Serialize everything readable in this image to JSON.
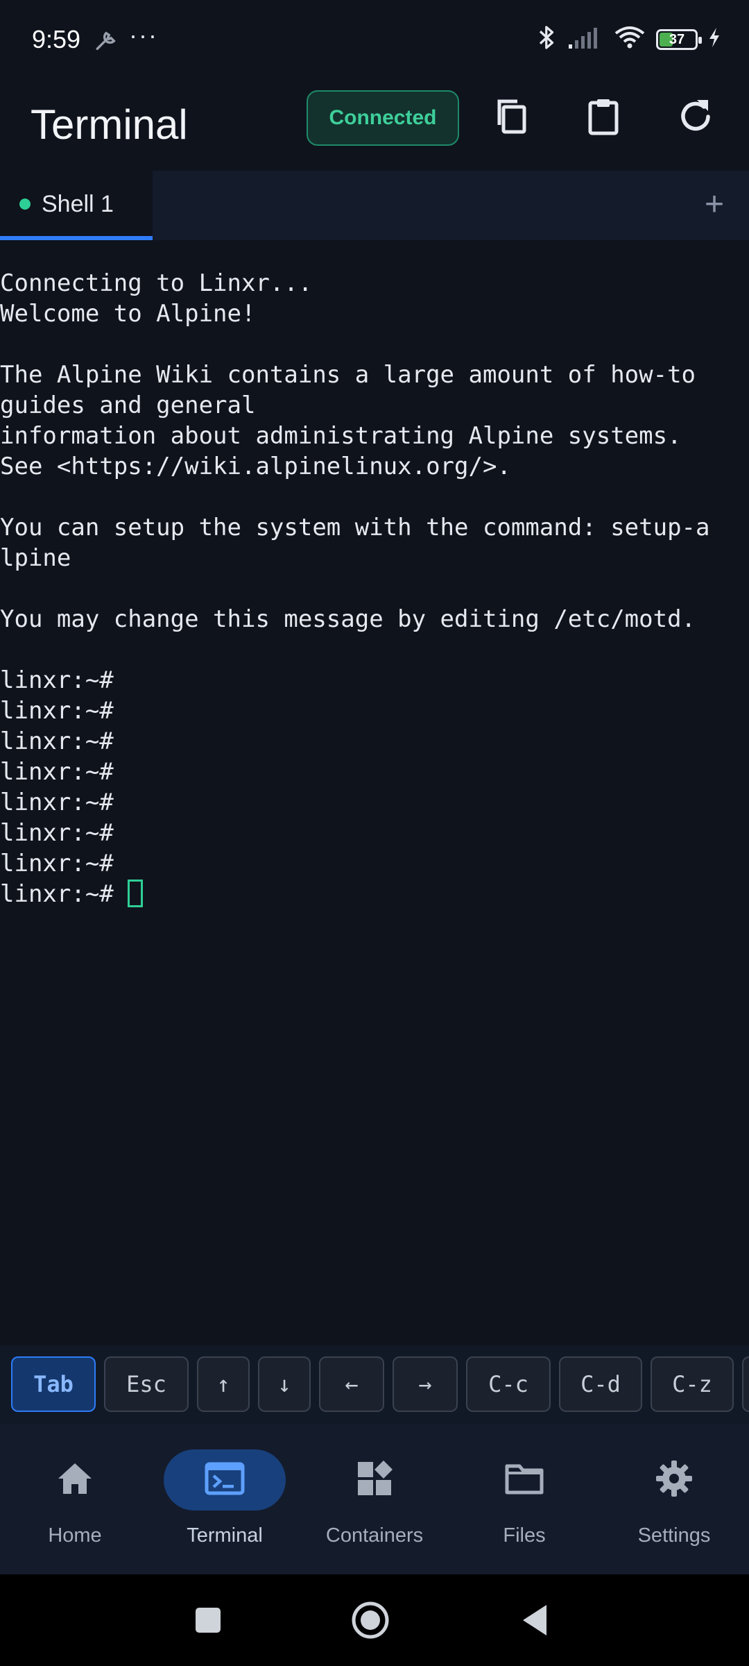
{
  "status_bar": {
    "time": "9:59",
    "dots": "···",
    "battery": "37",
    "icons": [
      "wrench-icon",
      "bluetooth-icon",
      "signal-icon",
      "wifi-icon",
      "battery-icon",
      "charging-icon"
    ]
  },
  "header": {
    "title": "Terminal",
    "connection_status": "Connected",
    "actions": [
      "copy-icon",
      "paste-icon",
      "refresh-icon"
    ]
  },
  "tabs": [
    {
      "label": "Shell 1",
      "active": true
    }
  ],
  "terminal": {
    "lines": [
      "Connecting to Linxr...",
      "Welcome to Alpine!",
      "",
      "The Alpine Wiki contains a large amount of how-to",
      "guides and general",
      "information about administrating Alpine systems.",
      "See <https://wiki.alpinelinux.org/>.",
      "",
      "You can setup the system with the command: setup-a",
      "lpine",
      "",
      "You may change this message by editing /etc/motd.",
      "",
      "linxr:~#",
      "linxr:~#",
      "linxr:~#",
      "linxr:~#",
      "linxr:~#",
      "linxr:~#",
      "linxr:~#"
    ],
    "prompt": "linxr:~#"
  },
  "extra_keys": [
    "Tab",
    "Esc",
    "↑",
    "↓",
    "←",
    "→",
    "C-c",
    "C-d",
    "C-z"
  ],
  "bottom_nav": [
    {
      "label": "Home",
      "icon": "home-icon"
    },
    {
      "label": "Terminal",
      "icon": "terminal-icon",
      "active": true
    },
    {
      "label": "Containers",
      "icon": "containers-icon"
    },
    {
      "label": "Files",
      "icon": "folder-icon"
    },
    {
      "label": "Settings",
      "icon": "gear-icon"
    }
  ],
  "colors": {
    "background": "#0f131c",
    "accent": "#2f7cf6",
    "connected": "#3ecf9a"
  }
}
